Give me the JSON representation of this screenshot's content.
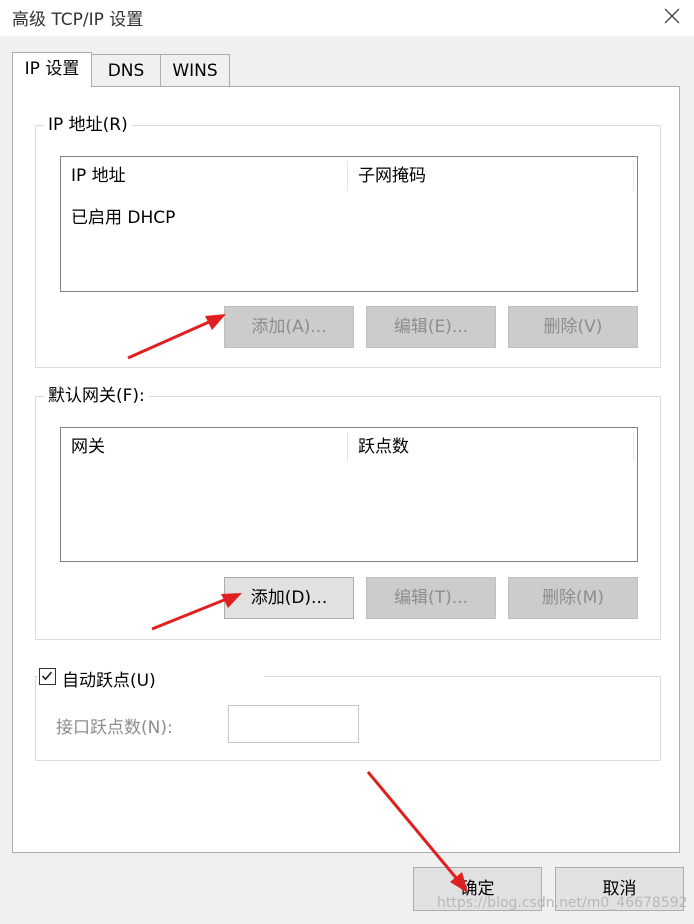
{
  "window": {
    "title": "高级 TCP/IP 设置",
    "close_icon": "close-icon"
  },
  "tabs": [
    {
      "label": "IP 设置",
      "active": true
    },
    {
      "label": "DNS",
      "active": false
    },
    {
      "label": "WINS",
      "active": false
    }
  ],
  "ip_section": {
    "legend": "IP 地址(R)",
    "columns": [
      "IP 地址",
      "子网掩码"
    ],
    "rows": [
      [
        "已启用 DHCP",
        ""
      ]
    ],
    "buttons": {
      "add": "添加(A)...",
      "edit": "编辑(E)...",
      "delete": "删除(V)"
    }
  },
  "gateway_section": {
    "legend": "默认网关(F):",
    "columns": [
      "网关",
      "跃点数"
    ],
    "buttons": {
      "add": "添加(D)...",
      "edit": "编辑(T)...",
      "delete": "删除(M)"
    }
  },
  "metric_section": {
    "auto_metric_label": "自动跃点(U)",
    "auto_metric_checked": true,
    "interface_metric_label": "接口跃点数(N):",
    "interface_metric_value": ""
  },
  "footer": {
    "ok": "确定",
    "cancel": "取消"
  },
  "watermark": "https://blog.csdn.net/m0_46678592",
  "colors": {
    "arrow": "#e02020",
    "disabled_text": "#8d8d8d",
    "panel": "#ffffff",
    "window_bg": "#f0f0f0"
  }
}
